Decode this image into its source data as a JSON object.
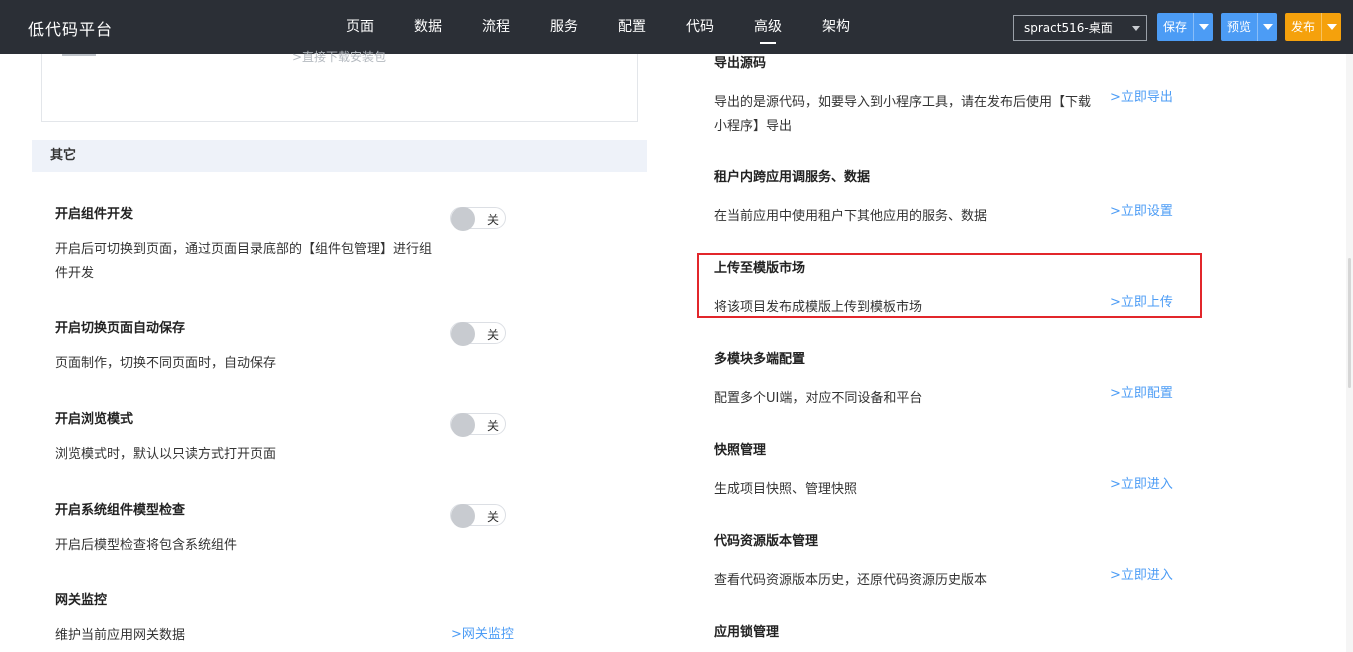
{
  "app": {
    "title": "低代码平台"
  },
  "nav": [
    {
      "label": "页面"
    },
    {
      "label": "数据"
    },
    {
      "label": "流程"
    },
    {
      "label": "服务"
    },
    {
      "label": "配置"
    },
    {
      "label": "代码"
    },
    {
      "label": "高级",
      "active": true
    },
    {
      "label": "架构"
    }
  ],
  "toolbar": {
    "project": "spract516-桌面",
    "save_label": "保存",
    "preview_label": "预览",
    "publish_label": "发布"
  },
  "left": {
    "download_link": ">直接下载安装包",
    "other_header": "其它",
    "settings": [
      {
        "title": "开启组件开发",
        "desc": "开启后可切换到页面，通过页面目录底部的【组件包管理】进行组件开发",
        "toggle": "关"
      },
      {
        "title": "开启切换页面自动保存",
        "desc": "页面制作，切换不同页面时，自动保存",
        "toggle": "关"
      },
      {
        "title": "开启浏览模式",
        "desc": "浏览模式时，默认以只读方式打开页面",
        "toggle": "关"
      },
      {
        "title": "开启系统组件模型检查",
        "desc": "开启后模型检查将包含系统组件",
        "toggle": "关"
      },
      {
        "title": "网关监控",
        "desc": "维护当前应用网关数据",
        "link": ">网关监控"
      }
    ]
  },
  "right": {
    "sections": [
      {
        "title": "导出源码",
        "desc": "导出的是源代码，如要导入到小程序工具，请在发布后使用【下载小程序】导出",
        "link": ">立即导出"
      },
      {
        "title": "租户内跨应用调服务、数据",
        "desc": "在当前应用中使用租户下其他应用的服务、数据",
        "link": ">立即设置"
      },
      {
        "title": "上传至模版市场",
        "desc": "将该项目发布成模版上传到模板市场",
        "link": ">立即上传",
        "highlighted": true
      },
      {
        "title": "多模块多端配置",
        "desc": "配置多个UI端，对应不同设备和平台",
        "link": ">立即配置"
      },
      {
        "title": "快照管理",
        "desc": "生成项目快照、管理快照",
        "link": ">立即进入"
      },
      {
        "title": "代码资源版本管理",
        "desc": "查看代码资源版本历史，还原代码资源历史版本",
        "link": ">立即进入"
      },
      {
        "title": "应用锁管理"
      }
    ]
  },
  "colors": {
    "topbar": "#2b2f36",
    "primary": "#4c9cf5",
    "publish": "#f5a10c",
    "highlight": "#e2262b"
  }
}
